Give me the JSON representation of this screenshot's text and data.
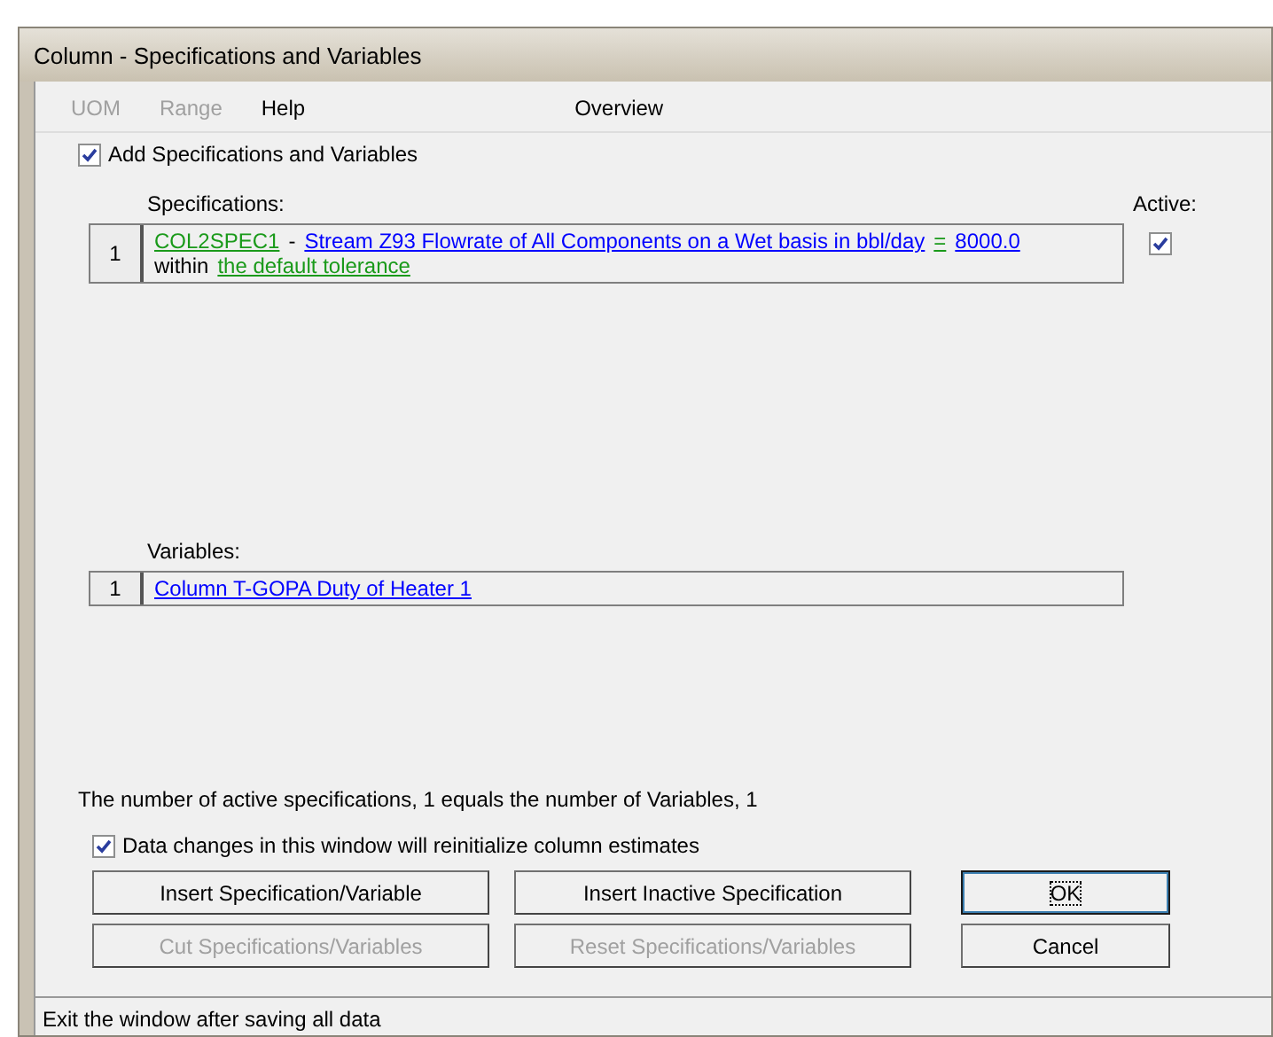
{
  "window": {
    "title": "Column - Specifications and Variables"
  },
  "menu": [
    {
      "label": "UOM",
      "disabled": true
    },
    {
      "label": "Range",
      "disabled": true
    },
    {
      "label": "Help",
      "disabled": false
    },
    {
      "label": "Overview",
      "disabled": false
    }
  ],
  "add_checkbox": {
    "label": "Add Specifications and Variables",
    "checked": true
  },
  "specifications": {
    "label": "Specifications:",
    "active_label": "Active:",
    "rows": [
      {
        "number": "1",
        "active": true,
        "lines": [
          [
            {
              "kind": "tag",
              "text": "COL2SPEC1"
            },
            {
              "kind": "text",
              "text": "-"
            },
            {
              "kind": "link",
              "text": "Stream Z93 Flowrate of All Components on a Wet basis in bbl/day"
            },
            {
              "kind": "tag",
              "text": "="
            },
            {
              "kind": "link",
              "text": "8000.0"
            }
          ],
          [
            {
              "kind": "text",
              "text": "within"
            },
            {
              "kind": "tag",
              "text": "the default tolerance"
            }
          ]
        ]
      }
    ]
  },
  "variables": {
    "label": "Variables:",
    "rows": [
      {
        "number": "1",
        "lines": [
          [
            {
              "kind": "link",
              "text": "Column T-GOPA Duty of Heater 1"
            }
          ]
        ]
      }
    ]
  },
  "summary": "The number of active specifications, 1 equals the number of Variables, 1",
  "reinit_checkbox": {
    "label": "Data changes in this window will reinitialize column estimates",
    "checked": true
  },
  "buttons": [
    [
      {
        "label": "Insert Specification/Variable",
        "disabled": false,
        "focused": false
      },
      {
        "label": "Insert Inactive Specification",
        "disabled": false,
        "focused": false
      },
      {
        "label": "OK",
        "disabled": false,
        "focused": true
      }
    ],
    [
      {
        "label": "Cut Specifications/Variables",
        "disabled": true,
        "focused": false
      },
      {
        "label": "Reset Specifications/Variables",
        "disabled": true,
        "focused": false
      },
      {
        "label": "Cancel",
        "disabled": false,
        "focused": false
      }
    ]
  ],
  "status_bar": "Exit the window after saving all data"
}
